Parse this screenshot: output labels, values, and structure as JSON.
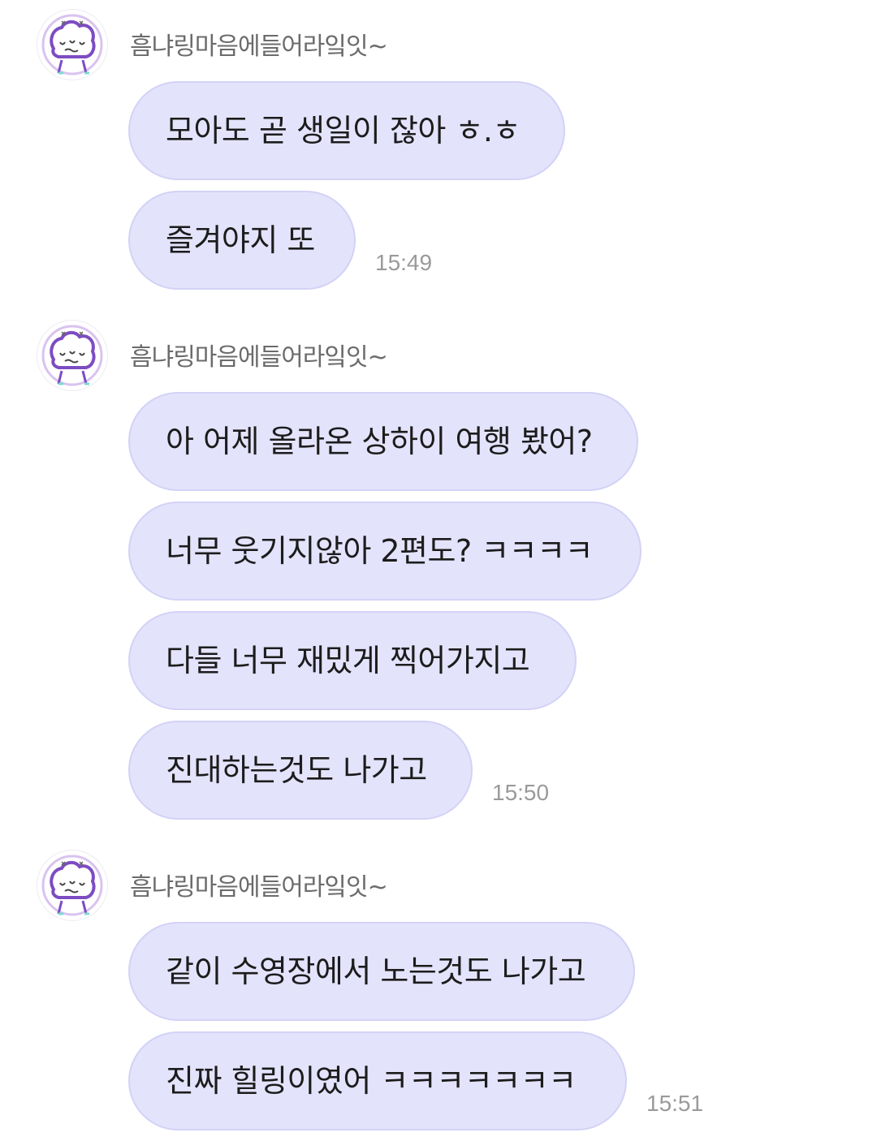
{
  "groups": [
    {
      "sender": "흠냐링마음에들어라잌잇~",
      "messages": [
        "모아도 곧 생일이 잖아 ㅎ.ㅎ",
        "즐겨야지 또"
      ],
      "time": "15:49"
    },
    {
      "sender": "흠냐링마음에들어라잌잇~",
      "messages": [
        "아 어제 올라온 상하이 여행 봤어?",
        "너무 웃기지않아 2편도? ㅋㅋㅋㅋ",
        "다들 너무 재밌게 찍어가지고",
        "진대하는것도 나가고"
      ],
      "time": "15:50"
    },
    {
      "sender": "흠냐링마음에들어라잌잇~",
      "messages": [
        "같이 수영장에서 노는것도 나가고",
        "진짜 힐링이였어 ㅋㅋㅋㅋㅋㅋㅋ"
      ],
      "time": "15:51"
    }
  ],
  "colors": {
    "bubble_bg": "#e4e3fc",
    "bubble_border": "#d3d2f6",
    "avatar_stroke": "#8a56c9",
    "sender_text": "#6b6b6b",
    "time_text": "#9a9a9a"
  },
  "icons": {
    "avatar": "crying-bread-character-avatar"
  }
}
